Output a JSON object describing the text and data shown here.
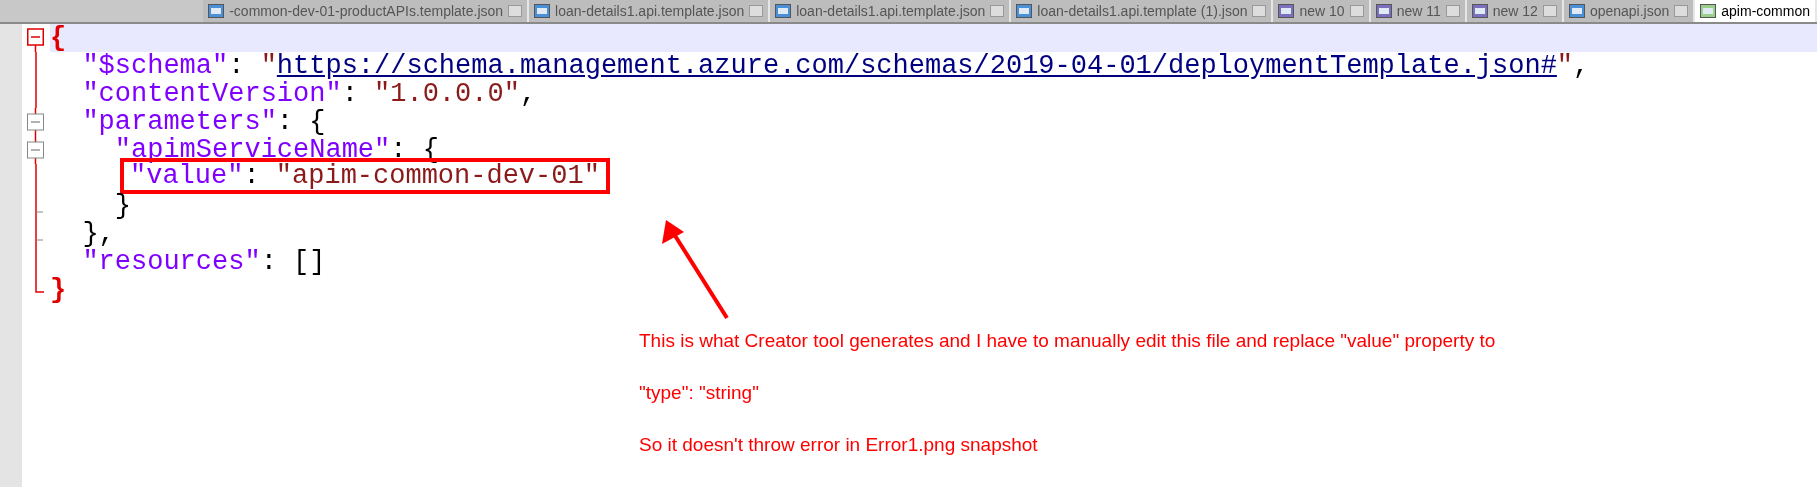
{
  "tabs": [
    {
      "label": "-common-dev-01-productAPIs.template.json",
      "kind": "file",
      "selected": false
    },
    {
      "label": "loan-details1.api.template.json",
      "kind": "file",
      "selected": false
    },
    {
      "label": "loan-details1.api.template.json",
      "kind": "file",
      "selected": false
    },
    {
      "label": "loan-details1.api.template (1).json",
      "kind": "file",
      "selected": false
    },
    {
      "label": "new 10",
      "kind": "new",
      "selected": false
    },
    {
      "label": "new 11",
      "kind": "new",
      "selected": false
    },
    {
      "label": "new 12",
      "kind": "new",
      "selected": false
    },
    {
      "label": "openapi.json",
      "kind": "file",
      "selected": false
    },
    {
      "label": "apim-common",
      "kind": "doc",
      "selected": true
    }
  ],
  "lines": [
    {
      "fold": {
        "kind": "start-active"
      },
      "current": true,
      "highlight": false,
      "tokens": [
        {
          "kind": "brace",
          "text": "{"
        }
      ]
    },
    {
      "fold": {
        "kind": "line"
      },
      "current": false,
      "highlight": false,
      "tokens": [
        {
          "kind": "key",
          "text": "  \"$schema\""
        },
        {
          "kind": "punct",
          "text": ": "
        },
        {
          "kind": "str",
          "text": "\""
        },
        {
          "kind": "link",
          "text": "https://schema.management.azure.com/schemas/2019-04-01/deploymentTemplate.json#"
        },
        {
          "kind": "str",
          "text": "\""
        },
        {
          "kind": "punct",
          "text": ","
        }
      ]
    },
    {
      "fold": {
        "kind": "line"
      },
      "current": false,
      "highlight": false,
      "tokens": [
        {
          "kind": "key",
          "text": "  \"contentVersion\""
        },
        {
          "kind": "punct",
          "text": ": "
        },
        {
          "kind": "str",
          "text": "\"1.0.0.0\""
        },
        {
          "kind": "punct",
          "text": ","
        }
      ]
    },
    {
      "fold": {
        "kind": "start"
      },
      "current": false,
      "highlight": false,
      "tokens": [
        {
          "kind": "key",
          "text": "  \"parameters\""
        },
        {
          "kind": "punct",
          "text": ": {"
        }
      ]
    },
    {
      "fold": {
        "kind": "start"
      },
      "current": false,
      "highlight": false,
      "tokens": [
        {
          "kind": "key",
          "text": "    \"apimServiceName\""
        },
        {
          "kind": "punct",
          "text": ": {"
        }
      ]
    },
    {
      "fold": {
        "kind": "line"
      },
      "current": false,
      "highlight": true,
      "tokens": [
        {
          "kind": "key",
          "text": "\"value\""
        },
        {
          "kind": "punct",
          "text": ": "
        },
        {
          "kind": "str",
          "text": "\"apim-common-dev-01\""
        }
      ]
    },
    {
      "fold": {
        "kind": "tick"
      },
      "current": false,
      "highlight": false,
      "tokens": [
        {
          "kind": "punct",
          "text": "    }"
        }
      ]
    },
    {
      "fold": {
        "kind": "tick"
      },
      "current": false,
      "highlight": false,
      "tokens": [
        {
          "kind": "punct",
          "text": "  },"
        }
      ]
    },
    {
      "fold": {
        "kind": "line"
      },
      "current": false,
      "highlight": false,
      "tokens": [
        {
          "kind": "key",
          "text": "  \"resources\""
        },
        {
          "kind": "punct",
          "text": ": []"
        }
      ]
    },
    {
      "fold": {
        "kind": "end"
      },
      "current": false,
      "highlight": false,
      "tokens": [
        {
          "kind": "brace",
          "text": "}"
        }
      ]
    }
  ],
  "note": [
    "This is what Creator tool generates and I have to manually edit this file and replace \"value\" property to",
    "\"type\": \"string\"",
    "So it doesn't throw error in Error1.png snapshot"
  ]
}
